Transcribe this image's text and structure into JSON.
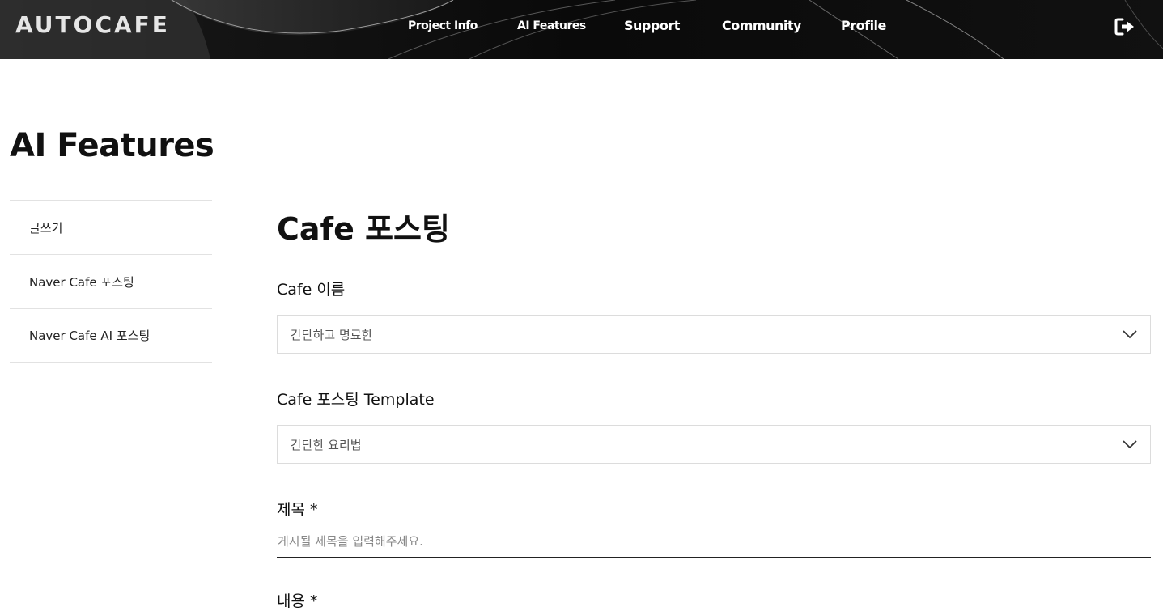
{
  "header": {
    "logo": "AUTOCAFE",
    "nav": [
      {
        "label": "Project Info"
      },
      {
        "label": "AI Features"
      },
      {
        "label": "Support"
      },
      {
        "label": "Community"
      },
      {
        "label": "Profile"
      }
    ],
    "logout_icon": "sign-out-icon"
  },
  "page": {
    "title": "AI Features"
  },
  "sidebar": {
    "items": [
      {
        "label": "글쓰기"
      },
      {
        "label": "Naver Cafe 포스팅"
      },
      {
        "label": "Naver Cafe AI 포스팅"
      }
    ]
  },
  "main": {
    "title": "Cafe 포스팅",
    "cafe_name": {
      "label": "Cafe 이름",
      "value": "간단하고 명료한"
    },
    "template": {
      "label": "Cafe 포스팅 Template",
      "value": "간단한 요리법"
    },
    "subject": {
      "label": "제목 *",
      "placeholder": "게시될 제목을 입력해주세요."
    },
    "content": {
      "label": "내용 *"
    }
  },
  "colors": {
    "header_bg": "#0b0b0b",
    "text": "#111111",
    "divider": "#e2e2e2"
  }
}
